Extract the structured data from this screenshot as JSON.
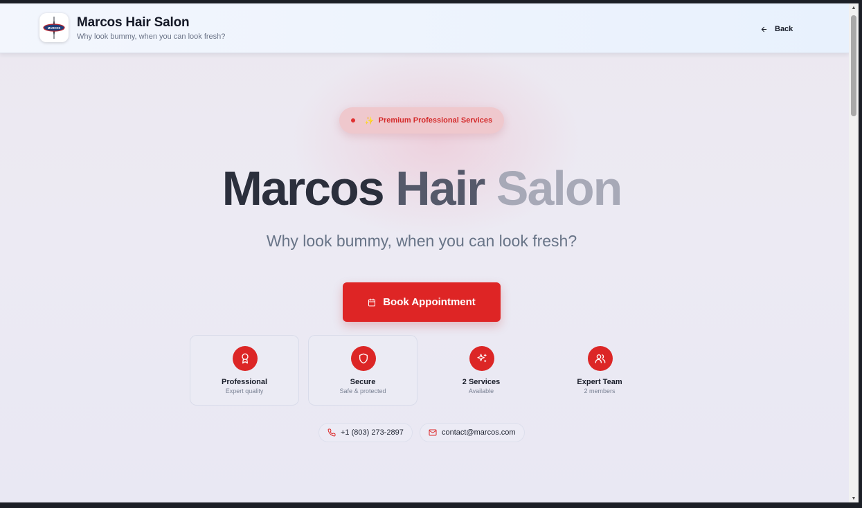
{
  "header": {
    "brand_title": "Marcos Hair Salon",
    "brand_subtitle": "Why look bummy, when you can look fresh?",
    "back_label": "Back",
    "logo_text": "MARCOS"
  },
  "hero": {
    "badge_emoji": "✨",
    "badge_text": "Premium Professional Services",
    "title_word1": "Marcos",
    "title_word2": "Hair",
    "title_word3": "Salon",
    "subtitle": "Why look bummy, when you can look fresh?",
    "book_label": "Book Appointment"
  },
  "features": [
    {
      "icon": "award-icon",
      "label": "Professional",
      "desc": "Expert quality"
    },
    {
      "icon": "shield-icon",
      "label": "Secure",
      "desc": "Safe & protected"
    },
    {
      "icon": "sparkles-icon",
      "label": "2 Services",
      "desc": "Available"
    },
    {
      "icon": "users-icon",
      "label": "Expert Team",
      "desc": "2 members"
    }
  ],
  "contact": {
    "phone": "+1 (803) 273-2897",
    "email": "contact@marcos.com"
  },
  "colors": {
    "accent": "#dc2626",
    "badge_bg": "#efc8cd",
    "title_dark": "#2b2f3c"
  }
}
